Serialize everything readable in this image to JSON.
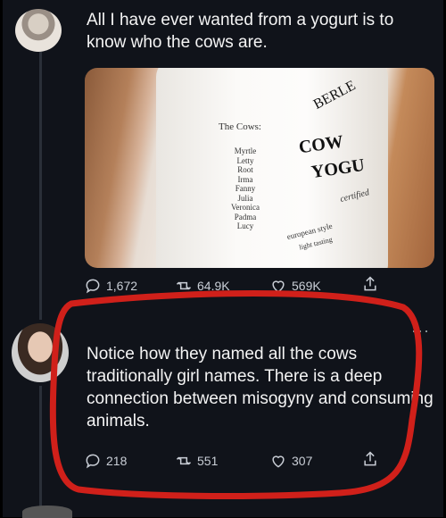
{
  "tweet1": {
    "text": "All I have ever wanted from a yogurt is to know who the cows are.",
    "image": {
      "cows_heading": "The Cows:",
      "cows": [
        "Myrtle",
        "Letty",
        "Root",
        "Irma",
        "Fanny",
        "Julia",
        "Veronica",
        "Padma",
        "Lucy"
      ],
      "brand": "BERLE",
      "headline1": "COW",
      "headline2": "YOGU",
      "certified": "certified",
      "style1": "european style",
      "style2": "light tasting"
    },
    "stats": {
      "replies": "1,672",
      "retweets": "64.9K",
      "likes": "569K"
    }
  },
  "tweet2": {
    "text": "Notice how they named all the cows traditionally girl names. There is a deep connection between misogyny and consuming animals.",
    "stats": {
      "replies": "218",
      "retweets": "551",
      "likes": "307"
    }
  },
  "colors": {
    "background": "#10131a",
    "text": "#f4f4f4",
    "icon": "#c9ced6",
    "annotation": "#d0201a"
  }
}
